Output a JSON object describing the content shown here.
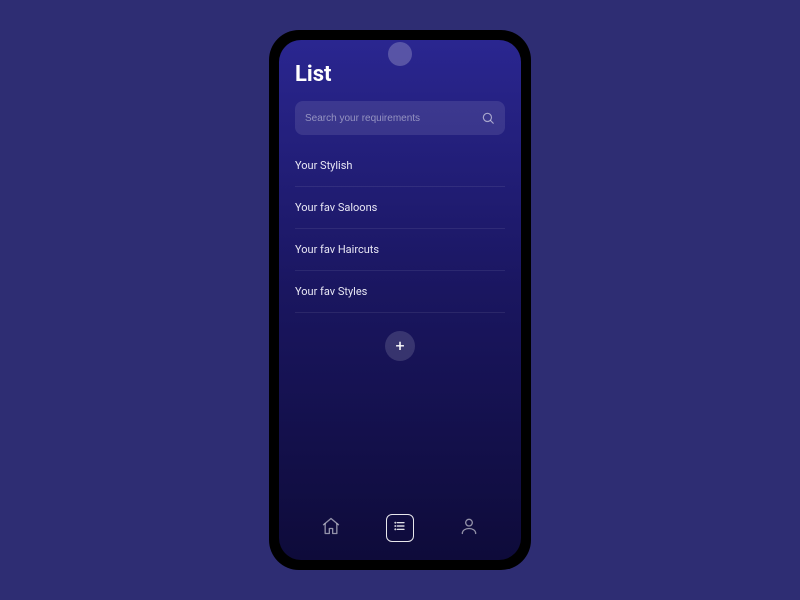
{
  "header": {
    "title": "List"
  },
  "search": {
    "placeholder": "Search your requirements"
  },
  "list": {
    "items": [
      {
        "label": "Your Stylish"
      },
      {
        "label": "Your fav Saloons"
      },
      {
        "label": "Your fav Haircuts"
      },
      {
        "label": "Your fav Styles"
      }
    ]
  },
  "add": {
    "glyph": "+"
  }
}
